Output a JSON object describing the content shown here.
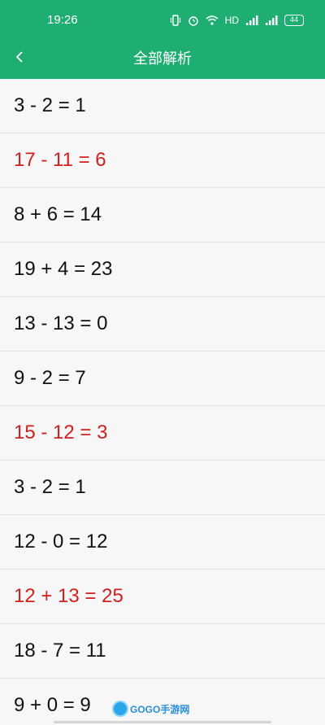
{
  "status_bar": {
    "time": "19:26",
    "network_label": "HD",
    "signal_1": "4G",
    "signal_2": "4G",
    "battery": "44"
  },
  "header": {
    "title": "全部解析",
    "background_color": "#1fae72"
  },
  "equations": [
    {
      "text": "3 - 2 = 1",
      "status": "correct"
    },
    {
      "text": "17 - 11 = 6",
      "status": "wrong"
    },
    {
      "text": "8 + 6 = 14",
      "status": "correct"
    },
    {
      "text": "19 + 4 = 23",
      "status": "correct"
    },
    {
      "text": "13 - 13 = 0",
      "status": "correct"
    },
    {
      "text": "9 - 2 = 7",
      "status": "correct"
    },
    {
      "text": "15 - 12 = 3",
      "status": "wrong"
    },
    {
      "text": "3 - 2 = 1",
      "status": "correct"
    },
    {
      "text": "12 - 0 = 12",
      "status": "correct"
    },
    {
      "text": "12 + 13 = 25",
      "status": "wrong"
    },
    {
      "text": "18 - 7 = 11",
      "status": "correct"
    },
    {
      "text": "9 + 0 = 9",
      "status": "correct"
    }
  ],
  "colors": {
    "correct": "#111111",
    "wrong": "#d01f1f"
  },
  "watermark": {
    "text": "GOGO手游网"
  }
}
